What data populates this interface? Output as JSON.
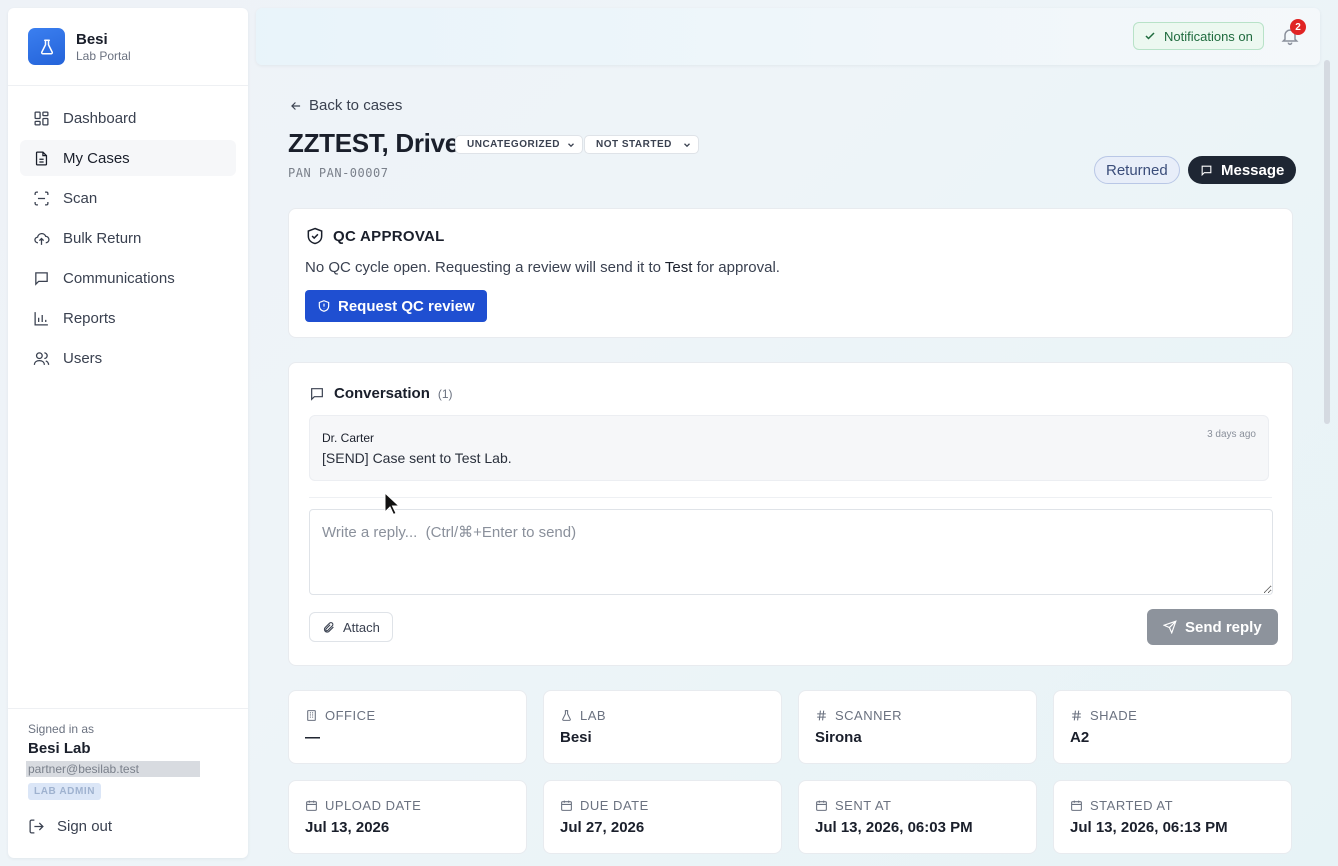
{
  "brand": {
    "name": "Besi",
    "subtitle": "Lab Portal",
    "accent": "#2f6fe4"
  },
  "sidebar": {
    "items": [
      {
        "label": "Dashboard",
        "icon": "dashboard-icon",
        "active": false
      },
      {
        "label": "My Cases",
        "icon": "document-icon",
        "active": true
      },
      {
        "label": "Scan",
        "icon": "scan-icon",
        "active": false
      },
      {
        "label": "Bulk Return",
        "icon": "cloud-upload-icon",
        "active": false
      },
      {
        "label": "Communications",
        "icon": "chat-icon",
        "active": false
      },
      {
        "label": "Reports",
        "icon": "bar-chart-icon",
        "active": false
      },
      {
        "label": "Users",
        "icon": "users-icon",
        "active": false
      }
    ],
    "user": {
      "signed_in_label": "Signed in as",
      "name": "Besi Lab",
      "email": "partner@besilab.test",
      "role": "LAB ADMIN"
    },
    "sign_out": "Sign out"
  },
  "topbar": {
    "notifications_label": "Notifications on",
    "notification_count": "2"
  },
  "case": {
    "back_label": "Back to cases",
    "title": "ZZTEST, Drive",
    "category": "UNCATEGORIZED",
    "progress": "NOT STARTED",
    "pan": "PAN PAN-00007",
    "status": "Returned",
    "message_button": "Message"
  },
  "qc": {
    "title": "QC APPROVAL",
    "text_before": "No QC cycle open. Requesting a review will send it to ",
    "text_target": "Test",
    "text_after": " for approval.",
    "button": "Request QC review",
    "button_color": "#1f4fd1"
  },
  "conversation": {
    "title": "Conversation",
    "count": "(1)",
    "messages": [
      {
        "author": "Dr. Carter",
        "time": "3 days ago",
        "body": "[SEND] Case sent to Test Lab."
      }
    ],
    "reply_placeholder": "Write a reply...  (Ctrl/⌘+Enter to send)",
    "attach_label": "Attach",
    "send_label": "Send reply"
  },
  "details": [
    {
      "label": "OFFICE",
      "value": "—",
      "icon": "building-icon"
    },
    {
      "label": "LAB",
      "value": "Besi",
      "icon": "flask-icon"
    },
    {
      "label": "SCANNER",
      "value": "Sirona",
      "icon": "hash-icon"
    },
    {
      "label": "SHADE",
      "value": "A2",
      "icon": "hash-icon"
    },
    {
      "label": "UPLOAD DATE",
      "value": "Jul 13, 2026",
      "icon": "calendar-icon"
    },
    {
      "label": "DUE DATE",
      "value": "Jul 27, 2026",
      "icon": "calendar-icon"
    },
    {
      "label": "SENT AT",
      "value": "Jul 13, 2026, 06:03 PM",
      "icon": "calendar-icon"
    },
    {
      "label": "STARTED AT",
      "value": "Jul 13, 2026, 06:13 PM",
      "icon": "calendar-icon"
    }
  ]
}
